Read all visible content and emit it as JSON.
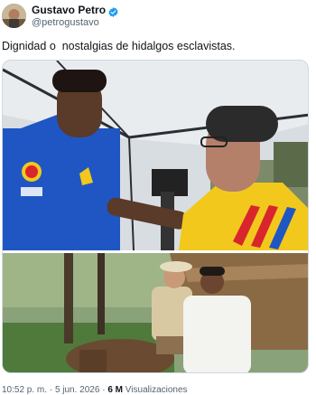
{
  "author": {
    "display_name": "Gustavo Petro",
    "handle": "@petrogustavo",
    "verified_icon": "verified-badge-icon",
    "verified_color": "#1d9bf0"
  },
  "tweet": {
    "text": "Dignidad o  nostalgias de hidalgos esclavistas."
  },
  "media": {
    "photo_top_badge": "ADIDAS",
    "jersey_colors": {
      "blue": "#1f56c4",
      "yellow": "#f2c81c",
      "red": "#d8262c"
    }
  },
  "meta": {
    "time": "10:52 p. m.",
    "separator": "·",
    "date": "5 jun. 2026",
    "views_count": "6 M",
    "views_label": "Visualizaciones"
  }
}
